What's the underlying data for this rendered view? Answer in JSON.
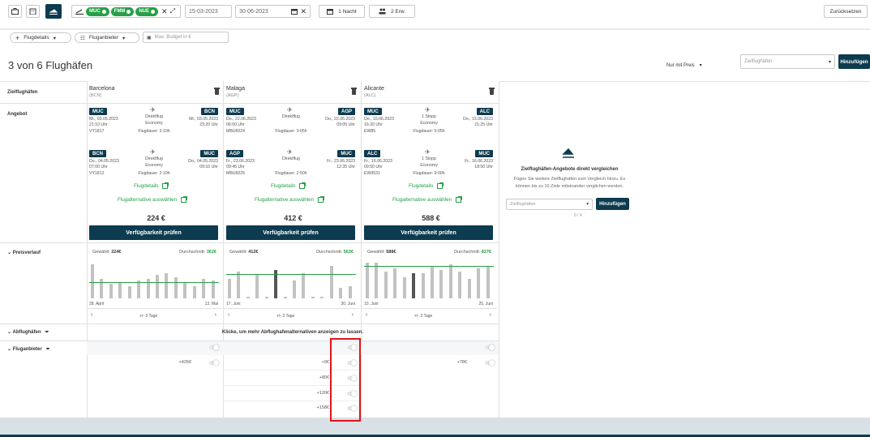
{
  "search": {
    "airport_chips": [
      "MUC",
      "FMM",
      "NUE"
    ],
    "date_from": "15-03-2023",
    "date_to": "30-06-2023",
    "nights": "1 Nacht",
    "travelers": "2 Erw.",
    "reset_label": "Zurücksetzen",
    "filter_flight_details": "Flugdetails",
    "filter_provider": "Fluganbieter",
    "budget_placeholder": "Max. Budget in €"
  },
  "results": {
    "heading": "3 von 6 Flughäfen",
    "sort_label": "Nur mit Preis",
    "target_airports_placeholder": "Zielflughäfen",
    "add_label": "Hinzufügen"
  },
  "row_labels": {
    "destinations": "Zielflughäfen",
    "offer": "Angebot",
    "price_trend": "Preisverlauf",
    "departure_airports": "Abflughäfen",
    "providers": "Fluganbieter"
  },
  "columns": [
    {
      "name": "Barcelona",
      "code": "(BCN)",
      "out": {
        "from": "MUC",
        "to": "BCN",
        "dep_date": "Mi., 03.05.2023",
        "dep_time": "21:10 Uhr",
        "flight_no": "VY1817",
        "type": "Direktflug",
        "cabin": "Economy",
        "duration": "Flugdauer: 2:10h",
        "arr_date": "Mi., 03.05.2023",
        "arr_time": "23:20 Uhr"
      },
      "ret": {
        "from": "BCN",
        "to": "MUC",
        "dep_date": "Do., 04.05.2023",
        "dep_time": "07:00 Uhr",
        "flight_no": "VY1812",
        "type": "Direktflug",
        "cabin": "Economy",
        "duration": "Flugdauer: 2:10h",
        "arr_date": "Do., 04.05.2023",
        "arr_time": "09:10 Uhr"
      },
      "details": "Flugdetails",
      "alt": "Flugalternative auswählen",
      "price": "224 €",
      "cta": "Verfügbarkeit prüfen",
      "chosen": "224€",
      "avg": "362€",
      "date_start": "28. April",
      "date_end": "13. Mai",
      "range": "+/- 3 Tage",
      "toggle_price": "+426€"
    },
    {
      "name": "Malaga",
      "code": "(AGP)",
      "out": {
        "from": "MUC",
        "to": "AGP",
        "dep_date": "Do., 22.06.2023",
        "dep_time": "06:00 Uhr",
        "flight_no": "MBU6024",
        "type": "Direktflug",
        "cabin": "",
        "duration": "Flugdauer: 3:05h",
        "arr_date": "Do., 22.06.2023",
        "arr_time": "09:05 Uhr"
      },
      "ret": {
        "from": "AGP",
        "to": "MUC",
        "dep_date": "Fr., 23.06.2023",
        "dep_time": "09:45 Uhr",
        "flight_no": "MBU6025",
        "type": "Direktflug",
        "cabin": "",
        "duration": "Flugdauer: 2:50h",
        "arr_date": "Fr., 23.06.2023",
        "arr_time": "12:35 Uhr"
      },
      "details": "Flugdetails",
      "alt": "Flugalternative auswählen",
      "price": "412 €",
      "cta": "Verfügbarkeit prüfen",
      "chosen": "412€",
      "avg": "562€",
      "date_start": "17. Juni",
      "date_end": "30. Juni",
      "range": "+/- 3 Tage",
      "toggle_prices": [
        "+9€",
        "+80€",
        "+120€",
        "+158€"
      ]
    },
    {
      "name": "Alicante",
      "code": "(ALC)",
      "out": {
        "from": "MUC",
        "to": "ALC",
        "dep_date": "Do., 15.06.2023",
        "dep_time": "16:20 Uhr",
        "flight_no": "EW85",
        "type": "1 Stopp",
        "cabin": "Economy",
        "duration": "Flugdauer: 5:05h",
        "arr_date": "Do., 15.06.2023",
        "arr_time": "21:25 Uhr"
      },
      "ret": {
        "from": "ALC",
        "to": "MUC",
        "dep_date": "Fr., 16.06.2023",
        "dep_time": "09:50 Uhr",
        "flight_no": "EW9531",
        "type": "1 Stopp",
        "cabin": "Economy",
        "duration": "Flugdauer: 9:00h",
        "arr_date": "Fr., 16.06.2023",
        "arr_time": "18:50 Uhr"
      },
      "details": "Flugdetails",
      "alt": "Flugalternative auswählen",
      "price": "588 €",
      "cta": "Verfügbarkeit prüfen",
      "chosen": "588€",
      "avg": "827€",
      "date_start": "10. Juni",
      "date_end": "25. Juni",
      "range": "+/- 3 Tage",
      "toggle_price": "+78€"
    }
  ],
  "price_charts": [
    {
      "chosen_index": -1,
      "relative_heights": [
        0.95,
        0.55,
        0.4,
        0.45,
        0.35,
        0.5,
        0.55,
        0.65,
        0.7,
        0.6,
        0.45,
        0.35,
        0.55,
        0.5
      ]
    },
    {
      "chosen_index": 5,
      "relative_heights": [
        0.55,
        0.75,
        0.05,
        0.65,
        0.05,
        0.8,
        0.05,
        0.5,
        0.7,
        0.05,
        0.05,
        0.9,
        0.3,
        0.35
      ]
    },
    {
      "chosen_index": 5,
      "relative_heights": [
        1.0,
        1.0,
        0.75,
        0.85,
        0.6,
        0.7,
        0.7,
        0.9,
        0.8,
        0.95,
        0.75,
        0.55,
        0.85,
        0.9
      ]
    }
  ],
  "compare_panel": {
    "title": "Zielflughäfen-Angebote direkt vergleichen",
    "text1": "Fügen Sie weitere Zielflughäfen zum Vergleich hinzu. Es",
    "text2": "können bis zu 10 Ziele miteinander verglichen werden.",
    "input_placeholder": "Zielflughäfen",
    "add_label": "Hinzufügen",
    "counter": "0 / 4"
  },
  "departure_hint": "Klicke, um mehr Abflughafenalternativen anzeigen zu lassen.",
  "colors": {
    "brand_dark": "#0d3b4f",
    "accent_green": "#26a047",
    "highlight_red": "#e0131a"
  }
}
